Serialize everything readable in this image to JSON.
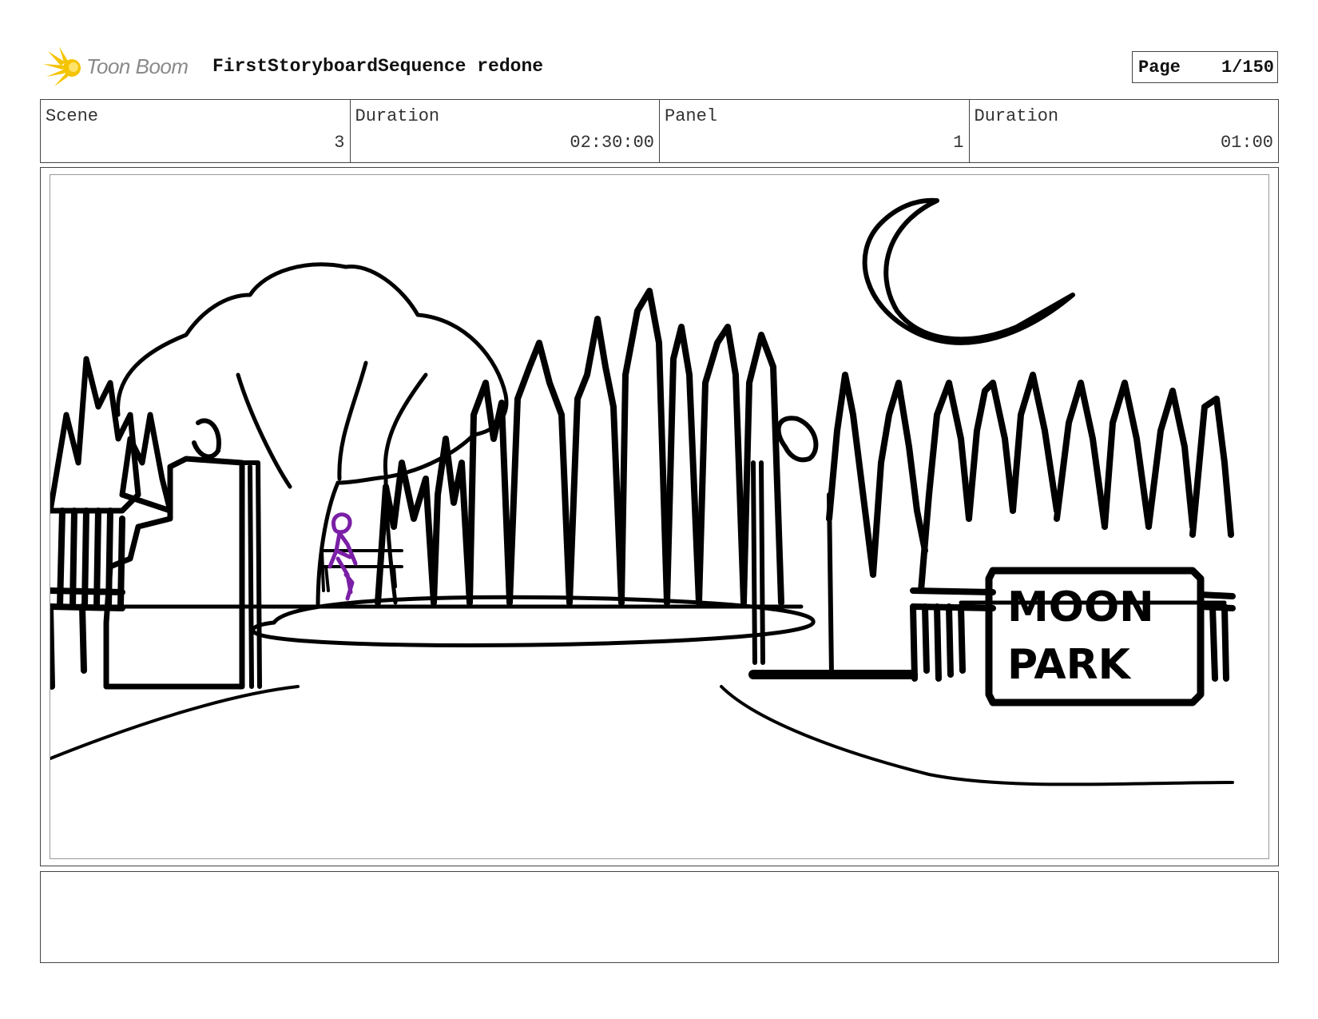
{
  "header": {
    "logo_text": "Toon Boom",
    "sequence_title": "FirstStoryboardSequence redone",
    "page_label": "Page",
    "page_value": "1/150"
  },
  "info": {
    "scene_label": "Scene",
    "scene_value": "3",
    "scene_duration_label": "Duration",
    "scene_duration_value": "02:30:00",
    "panel_label": "Panel",
    "panel_value": "1",
    "panel_duration_label": "Duration",
    "panel_duration_value": "01:00"
  },
  "panel": {
    "sign_line1": "MOON",
    "sign_line2": "PARK"
  },
  "colors": {
    "logo_yellow": "#f5c400",
    "ink": "#000000",
    "character_purple": "#7a1fa6"
  },
  "icons": {
    "logo": "toon-boom-burst-icon"
  }
}
